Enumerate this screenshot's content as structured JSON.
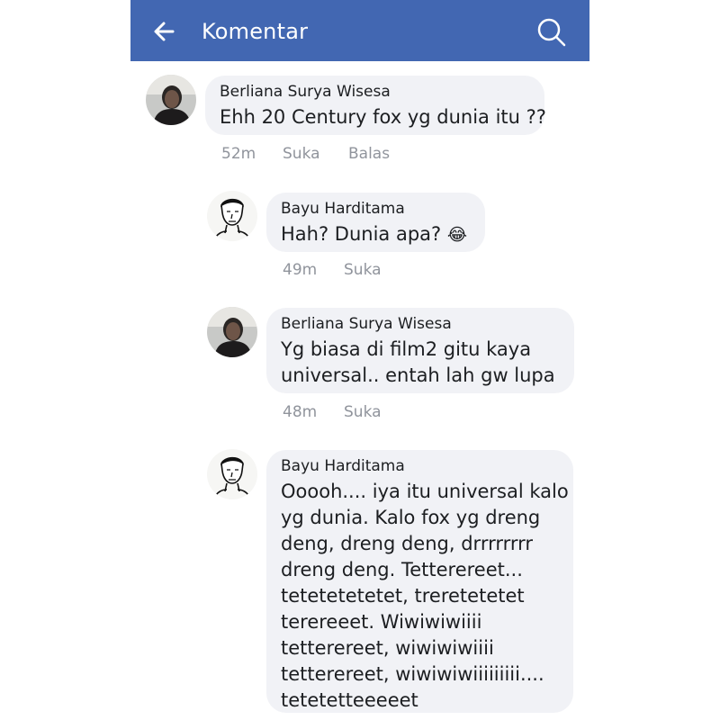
{
  "header": {
    "title": "Komentar",
    "back_icon": "arrow-left-icon",
    "search_icon": "search-icon",
    "bar_color": "#4267b2"
  },
  "comments": [
    {
      "author": "Berliana Surya Wisesa",
      "lines": [
        "Ehh 20 Century fox yg dunia itu ??"
      ],
      "time": "52m",
      "like": "Suka",
      "reply": "Balas"
    },
    {
      "author": "Bayu Harditama",
      "lines": [
        "Hah? Dunia apa?"
      ],
      "emoji": "😂",
      "emoji_name": "tears-of-joy-emoji-icon",
      "time": "49m",
      "like": "Suka"
    },
    {
      "author": "Berliana Surya Wisesa",
      "lines": [
        "Yg biasa di film2 gitu kaya",
        "universal.. entah lah gw lupa"
      ],
      "time": "48m",
      "like": "Suka"
    },
    {
      "author": "Bayu Harditama",
      "lines": [
        "Ooooh.... iya itu universal kalo",
        "yg dunia. Kalo fox yg dreng",
        "deng, dreng deng, drrrrrrrr",
        "dreng deng. Tetterereet...",
        "tetetetetetet, treretetetet",
        "terereeet. Wiwiwiwiiii",
        "tetterereet, wiwiwiwiiii",
        "tetterereet, wiwiwiwiiiiiiiii....",
        "tetetetteeeeet"
      ]
    }
  ]
}
